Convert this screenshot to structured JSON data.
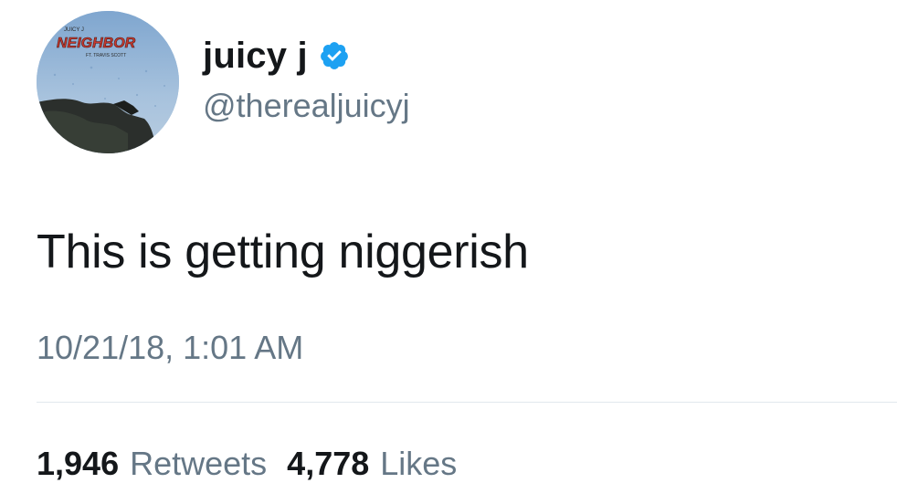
{
  "tweet": {
    "author": {
      "display_name": "juicy j",
      "handle": "@therealjuicyj",
      "verified_icon": "verified-badge-icon",
      "avatar": {
        "icon": "album-cover-avatar",
        "artist_text": "JUICY J",
        "title_text": "NEIGHBOR",
        "feature_text": "FT. TRAVIS SCOTT"
      }
    },
    "text": "This is getting niggerish",
    "timestamp": "10/21/18, 1:01 AM",
    "stats": {
      "retweets_count": "1,946",
      "retweets_label": "Retweets",
      "likes_count": "4,778",
      "likes_label": "Likes"
    }
  },
  "colors": {
    "text_primary": "#14171a",
    "text_secondary": "#657786",
    "verified_blue": "#1da1f2",
    "divider": "#e1e8ed",
    "background": "#ffffff"
  }
}
